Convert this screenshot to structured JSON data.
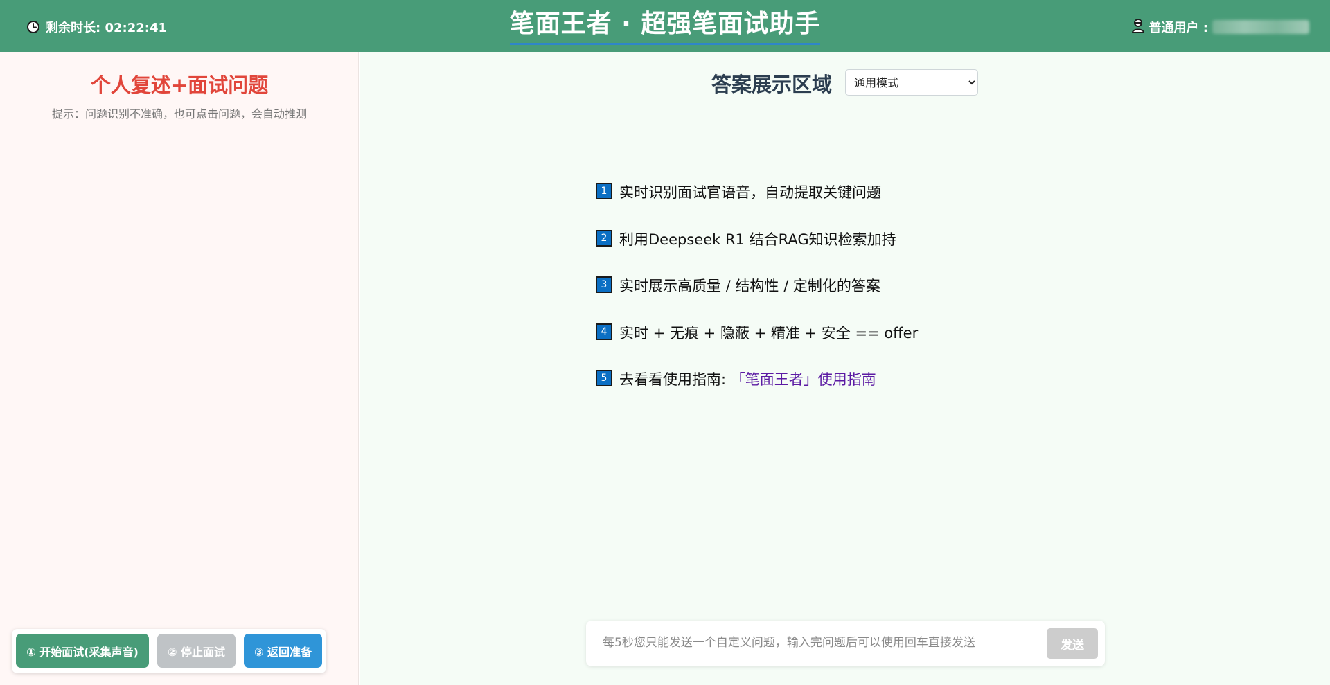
{
  "header": {
    "timer_label": "剩余时长: 02:22:41",
    "app_title": "笔面王者 · 超强笔面试助手",
    "user_label": "普通用户 :"
  },
  "left_panel": {
    "title": "个人复述+面试问题",
    "hint": "提示：问题识别不准确，也可点击问题，会自动推测",
    "buttons": {
      "start": "① 开始面试(采集声音)",
      "stop": "② 停止面试",
      "back": "③ 返回准备"
    }
  },
  "right_panel": {
    "title": "答案展示区域",
    "mode_select": {
      "selected": "通用模式"
    },
    "features": [
      {
        "num": "1",
        "text": "实时识别面试官语音，自动提取关键问题"
      },
      {
        "num": "2",
        "text": "利用Deepseek R1 结合RAG知识检索加持"
      },
      {
        "num": "3",
        "text": "实时展示高质量 / 结构性 / 定制化的答案"
      },
      {
        "num": "4",
        "text": "实时 + 无痕 + 隐蔽 + 精准 + 安全 == offer"
      },
      {
        "num": "5",
        "text": "去看看使用指南: ",
        "link": "「笔面王者」使用指南"
      }
    ],
    "composer": {
      "placeholder": "每5秒您只能发送一个自定义问题，输入完问题后可以使用回车直接发送",
      "send_label": "发送"
    }
  },
  "colors": {
    "header_bg": "#489c78",
    "title_red": "#e1463b",
    "badge_blue": "#0b6fc4",
    "link_purple": "#5b1aa3",
    "button_blue": "#2f95d8",
    "button_disabled": "#bfc3c6"
  },
  "icons": {
    "timer": "clock-icon",
    "user": "user-avatar-icon",
    "select": "chevron-down-icon"
  }
}
